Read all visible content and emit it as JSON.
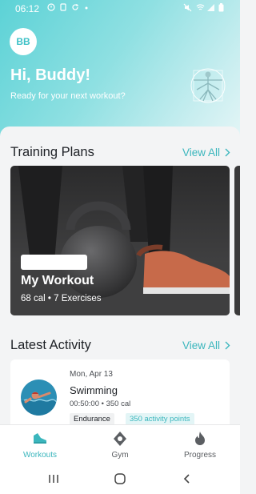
{
  "status_bar": {
    "time": "06:12"
  },
  "header": {
    "avatar_initials": "BB",
    "greeting": "Hi, Buddy!",
    "subtitle": "Ready for your next workout?"
  },
  "training_plans": {
    "title": "Training Plans",
    "view_all": "View All",
    "card": {
      "name": "My Workout",
      "meta": "68 cal • 7 Exercises"
    }
  },
  "latest_activity": {
    "title": "Latest Activity",
    "view_all": "View All",
    "item": {
      "date": "Mon, Apr 13",
      "name": "Swimming",
      "stats": "00:50:00 • 350 cal",
      "tags": [
        "Endurance",
        "350 activity points"
      ]
    }
  },
  "tab_bar": {
    "tabs": [
      {
        "label": "Workouts",
        "icon": "sneaker-icon",
        "active": true
      },
      {
        "label": "Gym",
        "icon": "location-pin-icon",
        "active": false
      },
      {
        "label": "Progress",
        "icon": "flame-icon",
        "active": false
      }
    ]
  },
  "colors": {
    "accent": "#3bb6bd",
    "header_gradient_start": "#5cd2d6"
  }
}
